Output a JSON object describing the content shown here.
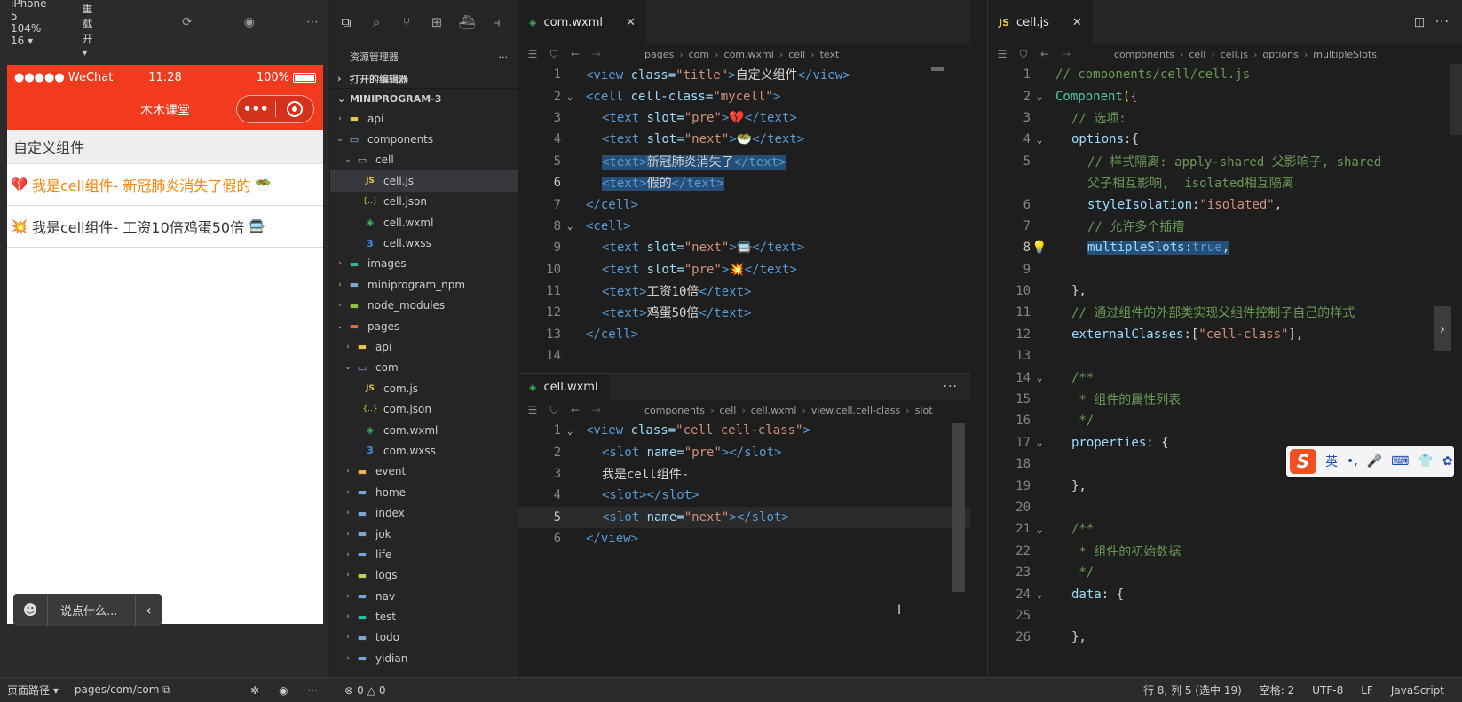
{
  "simulator": {
    "device": "iPhone 5 104% 16 ▾",
    "hot_reload": "热重载 开 ▾",
    "status_bar": {
      "carrier": "●●●●● WeChat",
      "time": "11:28",
      "battery": "100%",
      "battery_level": 1.0
    },
    "nav_title": "木木课堂",
    "page_heading": "自定义组件",
    "cells": [
      {
        "pre": "💔",
        "text": "我是cell组件- 新冠肺炎消失了假的",
        "next": "🥗",
        "color": "#f0880a"
      },
      {
        "pre": "💥",
        "text": "我是cell组件- 工资10倍鸡蛋50倍",
        "next": "🚍",
        "color": "#333333"
      }
    ],
    "chat_bar": {
      "label": "说点什么..."
    }
  },
  "explorer": {
    "title": "资源管理器",
    "open_editors": "打开的编辑器",
    "project": "MINIPROGRAM-3",
    "tree": [
      {
        "name": "api",
        "depth": 1,
        "chev": "›",
        "icon": "api"
      },
      {
        "name": "components",
        "depth": 1,
        "chev": "⌄",
        "icon": "folder-open"
      },
      {
        "name": "cell",
        "depth": 2,
        "chev": "⌄",
        "icon": "folder-open"
      },
      {
        "name": "cell.js",
        "depth": 3,
        "chev": "",
        "icon": "js",
        "selected": true
      },
      {
        "name": "cell.json",
        "depth": 3,
        "chev": "",
        "icon": "json"
      },
      {
        "name": "cell.wxml",
        "depth": 3,
        "chev": "",
        "icon": "wxml"
      },
      {
        "name": "cell.wxss",
        "depth": 3,
        "chev": "",
        "icon": "wxss"
      },
      {
        "name": "images",
        "depth": 1,
        "chev": "›",
        "icon": "img"
      },
      {
        "name": "miniprogram_npm",
        "depth": 1,
        "chev": "›",
        "icon": "folder"
      },
      {
        "name": "node_modules",
        "depth": 1,
        "chev": "›",
        "icon": "node"
      },
      {
        "name": "pages",
        "depth": 1,
        "chev": "⌄",
        "icon": "pages"
      },
      {
        "name": "api",
        "depth": 2,
        "chev": "›",
        "icon": "api"
      },
      {
        "name": "com",
        "depth": 2,
        "chev": "⌄",
        "icon": "folder-open"
      },
      {
        "name": "com.js",
        "depth": 3,
        "chev": "",
        "icon": "js"
      },
      {
        "name": "com.json",
        "depth": 3,
        "chev": "",
        "icon": "json"
      },
      {
        "name": "com.wxml",
        "depth": 3,
        "chev": "",
        "icon": "wxml"
      },
      {
        "name": "com.wxss",
        "depth": 3,
        "chev": "",
        "icon": "wxss"
      },
      {
        "name": "event",
        "depth": 2,
        "chev": "›",
        "icon": "event"
      },
      {
        "name": "home",
        "depth": 2,
        "chev": "›",
        "icon": "folder"
      },
      {
        "name": "index",
        "depth": 2,
        "chev": "›",
        "icon": "folder"
      },
      {
        "name": "jok",
        "depth": 2,
        "chev": "›",
        "icon": "folder"
      },
      {
        "name": "life",
        "depth": 2,
        "chev": "›",
        "icon": "folder"
      },
      {
        "name": "logs",
        "depth": 2,
        "chev": "›",
        "icon": "logs"
      },
      {
        "name": "nav",
        "depth": 2,
        "chev": "›",
        "icon": "folder"
      },
      {
        "name": "test",
        "depth": 2,
        "chev": "›",
        "icon": "test"
      },
      {
        "name": "todo",
        "depth": 2,
        "chev": "›",
        "icon": "folder"
      },
      {
        "name": "yidian",
        "depth": 2,
        "chev": "›",
        "icon": "folder"
      }
    ]
  },
  "editor_com": {
    "tab": "com.wxml",
    "crumbs": [
      "pages",
      "com",
      "com.wxml",
      "cell",
      "text"
    ],
    "current_line": 6,
    "lines": [
      {
        "n": 1,
        "fold": "",
        "indent": 0,
        "tokens": [
          [
            "t",
            "<view "
          ],
          [
            "a",
            "class="
          ],
          [
            "s",
            "\"title\""
          ],
          [
            "t",
            ">"
          ],
          [
            "x",
            "自定义组件"
          ],
          [
            "t",
            "</view>"
          ]
        ]
      },
      {
        "n": 2,
        "fold": "⌄",
        "indent": 0,
        "tokens": [
          [
            "t",
            "<cell "
          ],
          [
            "a",
            "cell-class="
          ],
          [
            "s",
            "\"mycell\""
          ],
          [
            "t",
            ">"
          ]
        ]
      },
      {
        "n": 3,
        "fold": "",
        "indent": 1,
        "tokens": [
          [
            "t",
            "<text "
          ],
          [
            "a",
            "slot="
          ],
          [
            "s",
            "\"pre\""
          ],
          [
            "t",
            ">"
          ],
          [
            "x",
            "💔"
          ],
          [
            "t",
            "</text>"
          ]
        ]
      },
      {
        "n": 4,
        "fold": "",
        "indent": 1,
        "tokens": [
          [
            "t",
            "<text "
          ],
          [
            "a",
            "slot="
          ],
          [
            "s",
            "\"next\""
          ],
          [
            "t",
            ">"
          ],
          [
            "x",
            "🥗"
          ],
          [
            "t",
            "</text>"
          ]
        ]
      },
      {
        "n": 5,
        "fold": "",
        "indent": 1,
        "hl": "sel",
        "tokens": [
          [
            "t",
            "<text>"
          ],
          [
            "x",
            "新冠肺炎消失了"
          ],
          [
            "t",
            "</text>"
          ]
        ]
      },
      {
        "n": 6,
        "fold": "",
        "indent": 1,
        "hl": "sel",
        "tokens": [
          [
            "t",
            "<text>"
          ],
          [
            "x",
            "假的"
          ],
          [
            "t",
            "</text>"
          ]
        ]
      },
      {
        "n": 7,
        "fold": "",
        "indent": 0,
        "tokens": [
          [
            "t",
            "</cell>"
          ]
        ]
      },
      {
        "n": 8,
        "fold": "⌄",
        "indent": 0,
        "tokens": [
          [
            "t",
            "<cell>"
          ]
        ]
      },
      {
        "n": 9,
        "fold": "",
        "indent": 1,
        "tokens": [
          [
            "t",
            "<text "
          ],
          [
            "a",
            "slot="
          ],
          [
            "s",
            "\"next\""
          ],
          [
            "t",
            ">"
          ],
          [
            "x",
            "🚍"
          ],
          [
            "t",
            "</text>"
          ]
        ]
      },
      {
        "n": 10,
        "fold": "",
        "indent": 1,
        "tokens": [
          [
            "t",
            "<text "
          ],
          [
            "a",
            "slot="
          ],
          [
            "s",
            "\"pre\""
          ],
          [
            "t",
            ">"
          ],
          [
            "x",
            "💥"
          ],
          [
            "t",
            "</text>"
          ]
        ]
      },
      {
        "n": 11,
        "fold": "",
        "indent": 1,
        "tokens": [
          [
            "t",
            "<text>"
          ],
          [
            "x",
            "工资10倍"
          ],
          [
            "t",
            "</text>"
          ]
        ]
      },
      {
        "n": 12,
        "fold": "",
        "indent": 1,
        "tokens": [
          [
            "t",
            "<text>"
          ],
          [
            "x",
            "鸡蛋50倍"
          ],
          [
            "t",
            "</text>"
          ]
        ]
      },
      {
        "n": 13,
        "fold": "",
        "indent": 0,
        "tokens": [
          [
            "t",
            "</cell>"
          ]
        ]
      },
      {
        "n": 14,
        "fold": "",
        "indent": 0,
        "tokens": []
      }
    ]
  },
  "editor_cellwxml": {
    "tab": "cell.wxml",
    "crumbs": [
      "components",
      "cell",
      "cell.wxml",
      "view.cell.cell-class",
      "slot"
    ],
    "current_line": 5,
    "lines": [
      {
        "n": 1,
        "fold": "⌄",
        "indent": 0,
        "tokens": [
          [
            "t",
            "<view "
          ],
          [
            "a",
            "class="
          ],
          [
            "s",
            "\"cell cell-class\""
          ],
          [
            "t",
            ">"
          ]
        ]
      },
      {
        "n": 2,
        "fold": "",
        "indent": 1,
        "tokens": [
          [
            "t",
            "<slot "
          ],
          [
            "a",
            "name="
          ],
          [
            "s",
            "\"pre\""
          ],
          [
            "t",
            "></slot>"
          ]
        ]
      },
      {
        "n": 3,
        "fold": "",
        "indent": 1,
        "tokens": [
          [
            "x",
            "我是cell组件-"
          ]
        ]
      },
      {
        "n": 4,
        "fold": "",
        "indent": 1,
        "tokens": [
          [
            "t",
            "<slot></slot>"
          ]
        ]
      },
      {
        "n": 5,
        "fold": "",
        "indent": 1,
        "hl": "cur",
        "tokens": [
          [
            "t",
            "<slot "
          ],
          [
            "a",
            "name="
          ],
          [
            "s",
            "\"next\""
          ],
          [
            "t",
            "></slot>"
          ]
        ]
      },
      {
        "n": 6,
        "fold": "",
        "indent": 0,
        "tokens": [
          [
            "t",
            "</view>"
          ]
        ]
      }
    ]
  },
  "editor_celljs": {
    "tab": "cell.js",
    "crumbs": [
      "components",
      "cell",
      "cell.js",
      "options",
      "multipleSlots"
    ],
    "current_line": 8,
    "lines": [
      {
        "n": "1",
        "fold": "",
        "indent": 0,
        "tokens": [
          [
            "c",
            "// components/cell/cell.js"
          ]
        ]
      },
      {
        "n": "2",
        "fold": "⌄",
        "indent": 0,
        "tokens": [
          [
            "f",
            "Component"
          ],
          [
            "b",
            "("
          ],
          [
            "b2",
            "{"
          ]
        ]
      },
      {
        "n": "3",
        "fold": "",
        "indent": 1,
        "tokens": [
          [
            "c",
            "// 选项:"
          ]
        ]
      },
      {
        "n": "4",
        "fold": "⌄",
        "indent": 1,
        "tokens": [
          [
            "k",
            "options"
          ],
          [
            "p",
            ":{"
          ]
        ]
      },
      {
        "n": "5",
        "fold": "",
        "indent": 2,
        "tokens": [
          [
            "c",
            "// 样式隔离: apply-shared 父影响子, shared"
          ]
        ]
      },
      {
        "n": "",
        "fold": "",
        "indent": 2,
        "tokens": [
          [
            "c",
            "父子相互影响,  isolated相互隔离"
          ]
        ]
      },
      {
        "n": "6",
        "fold": "",
        "indent": 2,
        "tokens": [
          [
            "k",
            "styleIsolation"
          ],
          [
            "p",
            ":"
          ],
          [
            "s",
            "\"isolated\""
          ],
          [
            "p",
            ","
          ]
        ]
      },
      {
        "n": "7",
        "fold": "",
        "indent": 2,
        "tokens": [
          [
            "c",
            "// 允许多个插槽"
          ]
        ]
      },
      {
        "n": "8",
        "fold": "",
        "indent": 2,
        "hl": "sel",
        "bulb": true,
        "tokens": [
          [
            "k",
            "multipleSlots"
          ],
          [
            "p",
            ":"
          ],
          [
            "w",
            "true"
          ],
          [
            "p",
            ","
          ]
        ]
      },
      {
        "n": "9",
        "fold": "",
        "indent": 2,
        "tokens": []
      },
      {
        "n": "10",
        "fold": "",
        "indent": 1,
        "tokens": [
          [
            "p",
            "},"
          ]
        ]
      },
      {
        "n": "11",
        "fold": "",
        "indent": 1,
        "tokens": [
          [
            "c",
            "// 通过组件的外部类实现父组件控制子自己的样式"
          ]
        ]
      },
      {
        "n": "12",
        "fold": "",
        "indent": 1,
        "tokens": [
          [
            "k",
            "externalClasses"
          ],
          [
            "p",
            ":["
          ],
          [
            "s",
            "\"cell-class\""
          ],
          [
            "p",
            "],"
          ]
        ]
      },
      {
        "n": "13",
        "fold": "",
        "indent": 1,
        "tokens": []
      },
      {
        "n": "14",
        "fold": "⌄",
        "indent": 1,
        "tokens": [
          [
            "c",
            "/**"
          ]
        ]
      },
      {
        "n": "15",
        "fold": "",
        "indent": 1,
        "tokens": [
          [
            "c",
            " * 组件的属性列表"
          ]
        ]
      },
      {
        "n": "16",
        "fold": "",
        "indent": 1,
        "tokens": [
          [
            "c",
            " */"
          ]
        ]
      },
      {
        "n": "17",
        "fold": "⌄",
        "indent": 1,
        "tokens": [
          [
            "k",
            "properties"
          ],
          [
            "p",
            ": {"
          ]
        ]
      },
      {
        "n": "18",
        "fold": "",
        "indent": 1,
        "tokens": []
      },
      {
        "n": "19",
        "fold": "",
        "indent": 1,
        "tokens": [
          [
            "p",
            "},"
          ]
        ]
      },
      {
        "n": "20",
        "fold": "",
        "indent": 1,
        "tokens": []
      },
      {
        "n": "21",
        "fold": "⌄",
        "indent": 1,
        "tokens": [
          [
            "c",
            "/**"
          ]
        ]
      },
      {
        "n": "22",
        "fold": "",
        "indent": 1,
        "tokens": [
          [
            "c",
            " * 组件的初始数据"
          ]
        ]
      },
      {
        "n": "23",
        "fold": "",
        "indent": 1,
        "tokens": [
          [
            "c",
            " */"
          ]
        ]
      },
      {
        "n": "24",
        "fold": "⌄",
        "indent": 1,
        "tokens": [
          [
            "k",
            "data"
          ],
          [
            "p",
            ": {"
          ]
        ]
      },
      {
        "n": "25",
        "fold": "",
        "indent": 1,
        "tokens": []
      },
      {
        "n": "26",
        "fold": "",
        "indent": 1,
        "tokens": [
          [
            "p",
            "},"
          ]
        ]
      }
    ]
  },
  "status": {
    "page_path_label": "页面路径 ▾",
    "page_path": "pages/com/com",
    "errors": "0",
    "warnings": "0",
    "cursor": "行 8, 列 5 (选中 19)",
    "spaces": "空格: 2",
    "encoding": "UTF-8",
    "eol": "LF",
    "language": "JavaScript"
  },
  "ime": {
    "lang": "英",
    "items": [
      "•,",
      "🎤",
      "⌨",
      "👕",
      "✿"
    ]
  }
}
